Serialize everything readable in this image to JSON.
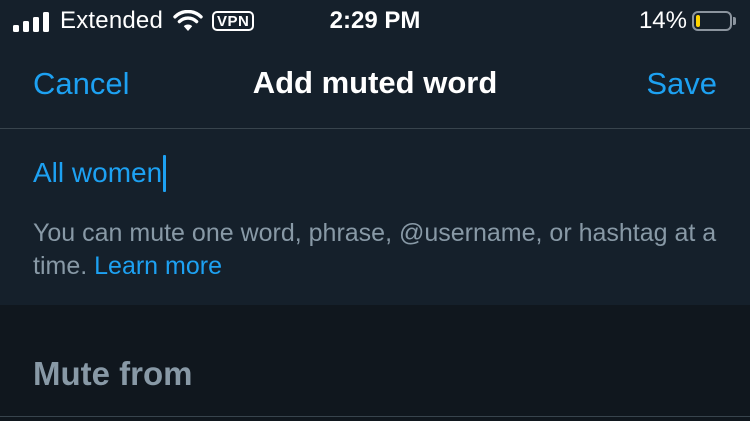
{
  "status_bar": {
    "carrier": "Extended",
    "vpn_label": "VPN",
    "time": "2:29 PM",
    "battery_percent_text": "14%",
    "battery_level": 0.14,
    "battery_color": "#ffd400",
    "signal_bars_active": 4,
    "icons": [
      "signal-icon",
      "wifi-icon",
      "vpn-badge",
      "battery-icon"
    ]
  },
  "nav": {
    "cancel_label": "Cancel",
    "title": "Add muted word",
    "save_label": "Save"
  },
  "word_input": {
    "value": "All women"
  },
  "hint": {
    "text": "You can mute one word, phrase, @username, or hashtag at a time.",
    "link_label": "Learn more"
  },
  "mute_from": {
    "header": "Mute from"
  },
  "colors": {
    "background": "#15202b",
    "section_background": "#10171e",
    "accent": "#1da1f2",
    "secondary_text": "#8899a6",
    "divider": "#38444d"
  }
}
